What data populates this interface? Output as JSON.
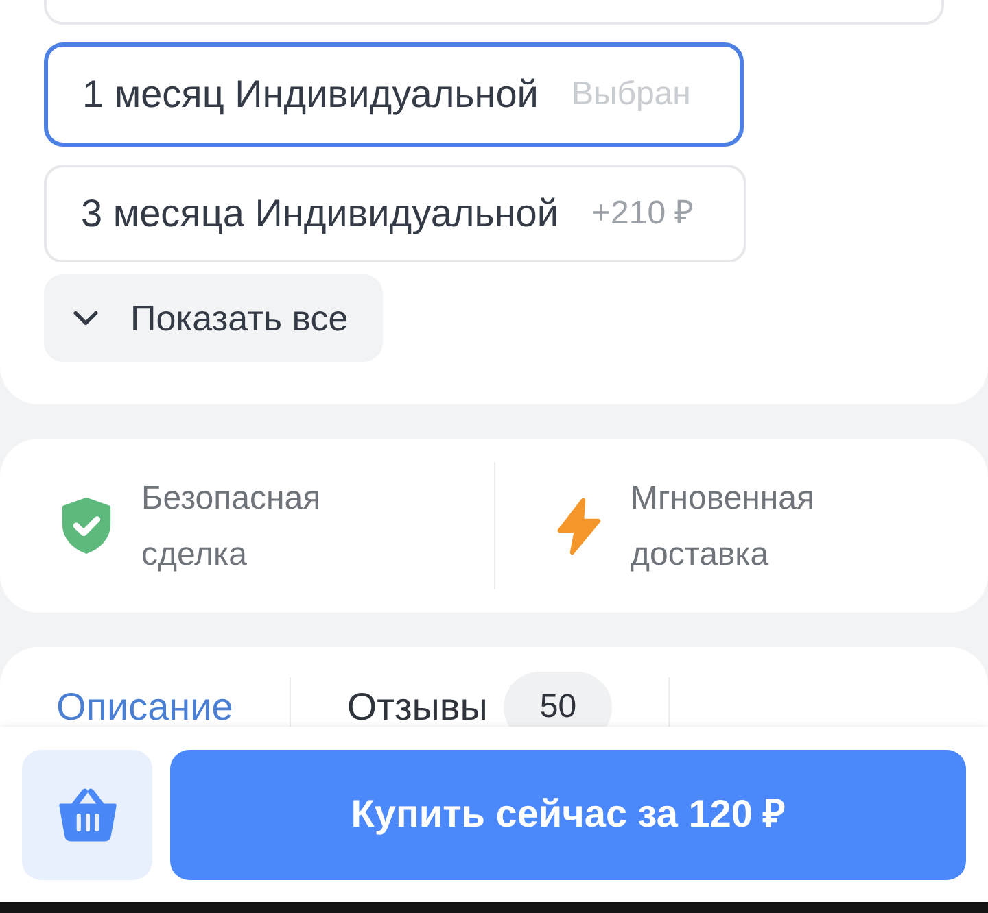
{
  "options": [
    {
      "selected": false
    },
    {
      "label": "1 месяц Индивидуальной",
      "note": "Выбран",
      "selected": true
    },
    {
      "label": "3 месяца Индивидуальной",
      "note": "+210 ₽",
      "selected": false
    }
  ],
  "show_all_button": {
    "label": "Показать все"
  },
  "features": [
    {
      "kind": "secure",
      "label": "Безопасная сделка"
    },
    {
      "kind": "instant",
      "label": "Мгновенная доставка"
    }
  ],
  "tabs": [
    {
      "label": "Описание",
      "selected": true
    },
    {
      "label": "Отзывы",
      "count": "50",
      "selected": false
    }
  ],
  "buy_button": {
    "label": "Купить сейчас за 120 ₽"
  }
}
